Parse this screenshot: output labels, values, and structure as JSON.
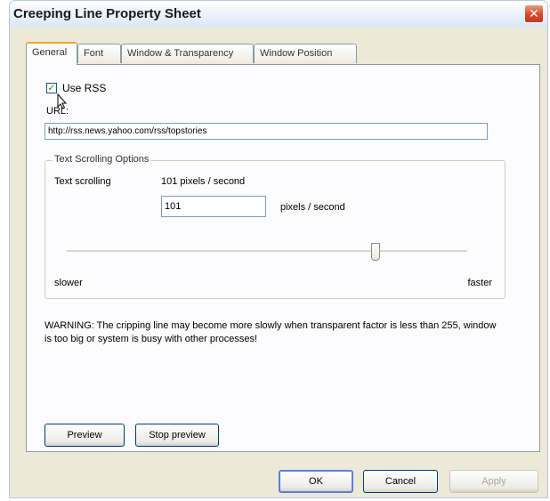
{
  "window": {
    "title": "Creeping Line Property Sheet"
  },
  "tabs": [
    {
      "label": "General"
    },
    {
      "label": "Font"
    },
    {
      "label": "Window & Transparency"
    },
    {
      "label": "Window Position"
    }
  ],
  "general": {
    "use_rss_label": "Use RSS",
    "use_rss_checked": true,
    "url_label": "URL:",
    "url_value": "http://rss.news.yahoo.com/rss/topstories",
    "scroll_group_label": "Text Scrolling Options",
    "text_scrolling_label": "Text scrolling",
    "speed_readout": "101 pixels / second",
    "speed_value": "101",
    "speed_units": "pixels / second",
    "slider_min_label": "slower",
    "slider_max_label": "faster",
    "slider_fraction": 0.77,
    "warning_text": "WARNING: The cripping line may become more slowly when transparent factor is less than 255, window is too big or system is busy with other processes!",
    "preview_label": "Preview",
    "stop_preview_label": "Stop preview"
  },
  "footer": {
    "ok_label": "OK",
    "cancel_label": "Cancel",
    "apply_label": "Apply"
  }
}
